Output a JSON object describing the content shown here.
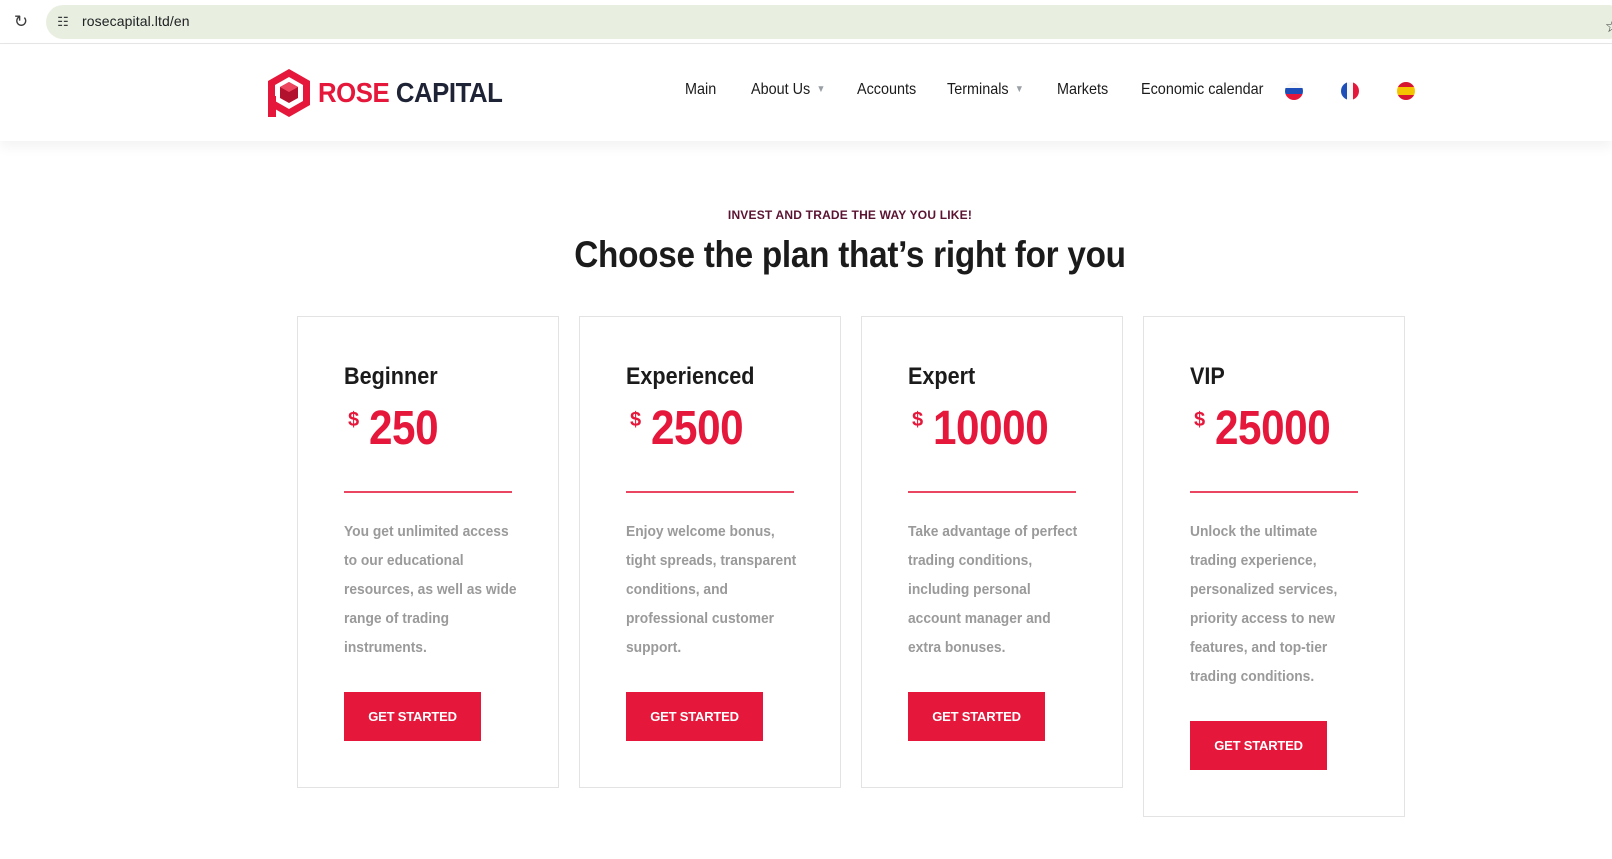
{
  "browser": {
    "url": "rosecapital.ltd/en",
    "reload_icon": "reload-icon",
    "site_info_icon": "site-info-icon",
    "bookmark_icon": "star-icon"
  },
  "header": {
    "logo": {
      "word1": "ROSE",
      "word2": "CAPITAL",
      "icon": "rose-capital-logo-icon"
    },
    "nav": [
      {
        "label": "Main",
        "dropdown": false
      },
      {
        "label": "About Us",
        "dropdown": true
      },
      {
        "label": "Accounts",
        "dropdown": false
      },
      {
        "label": "Terminals",
        "dropdown": true
      },
      {
        "label": "Markets",
        "dropdown": false
      },
      {
        "label": "Economic calendar",
        "dropdown": false
      }
    ],
    "languages": [
      {
        "icon": "russia-flag-icon"
      },
      {
        "icon": "france-flag-icon"
      },
      {
        "icon": "spain-flag-icon"
      }
    ]
  },
  "section": {
    "eyebrow": "INVEST AND TRADE THE WAY YOU LIKE!",
    "title": "Choose the plan that’s right for you"
  },
  "plans": [
    {
      "name": "Beginner",
      "currency": "$",
      "amount": "250",
      "description": "You get unlimited access to our educational resources, as well as wide range of trading instruments.",
      "button": "GET STARTED"
    },
    {
      "name": "Experienced",
      "currency": "$",
      "amount": "2500",
      "description": "Enjoy welcome bonus, tight spreads, transparent conditions, and professional customer support.",
      "button": "GET STARTED"
    },
    {
      "name": "Expert",
      "currency": "$",
      "amount": "10000",
      "description": "Take advantage of perfect trading conditions, including personal account manager and extra bonuses.",
      "button": "GET STARTED"
    },
    {
      "name": "VIP",
      "currency": "$",
      "amount": "25000",
      "description": "Unlock the ultimate trading experience, personalized services, priority access to new features, and top-tier trading conditions.",
      "button": "GET STARTED"
    }
  ],
  "colors": {
    "brand_red": "#e5173a",
    "brand_navy": "#1e2436",
    "eyebrow": "#5b1332",
    "muted_text": "#9a9a9a"
  }
}
